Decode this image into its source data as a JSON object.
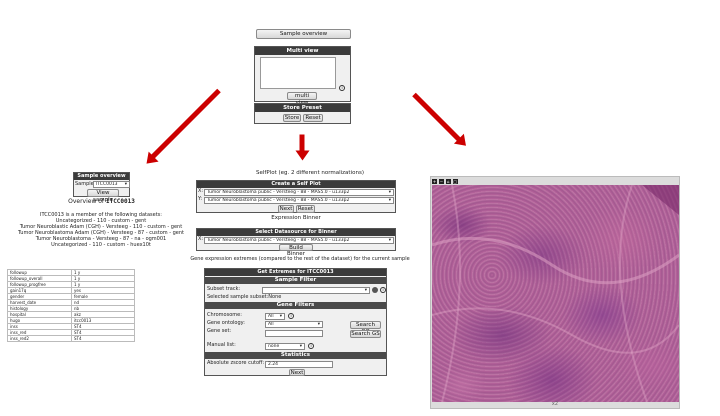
{
  "top": {
    "sample_overview_button": "Sample overview",
    "multi_view_title": "Multi view",
    "multi_view_button": "multi view",
    "store_preset_title": "Store Preset",
    "store_button": "Store",
    "reset_button": "Reset"
  },
  "overview": {
    "panel_title": "Sample overview",
    "sample_label": "Sample",
    "sample_value": "ITCC0013",
    "view_button": "View sample",
    "heading_prefix": "Overview of ",
    "heading_id": "ITCC0013",
    "member_text": "ITCC0013 is a member of the following datasets:",
    "datasets": [
      "Uncategorized - 110 - custom - gent",
      "Tumor Neuroblastic Adam (CGH) - Versteeg - 110 - custom - gent",
      "Tumor Neuroblastoma Adam (CGH) - Versteeg - 87 - custom - gent",
      "Tumor Neuroblastoma - Versteeg - 87 - na - ogm001",
      "Uncategorized - 110 - custom - huex10t"
    ],
    "attributes": [
      [
        "followup",
        "1 y"
      ],
      [
        "followup_overall",
        "1 y"
      ],
      [
        "followup_progfree",
        "1 y"
      ],
      [
        "gain17q",
        "yes"
      ],
      [
        "gender",
        "female"
      ],
      [
        "harvest_date",
        "nd"
      ],
      [
        "histology",
        "nb"
      ],
      [
        "hospital",
        "akz"
      ],
      [
        "hugo",
        "itcc0013"
      ],
      [
        "inss",
        "ST4"
      ],
      [
        "inss_red",
        "ST4"
      ],
      [
        "inss_red2",
        "ST4"
      ]
    ]
  },
  "middle": {
    "selfplot_caption": "SelfPlot (eg. 2 different normalizations)",
    "create_title": "Create a Self Plot",
    "x_label": "X:",
    "y_label": "Y:",
    "x_value": "Tumor Neuroblastoma public - Versteeg - 88 - MAS5.0 - u133p2",
    "y_value": "Tumor Neuroblastoma public - Versteeg - 88 - MAS5.0 - u133p2",
    "next_button": "Next",
    "reset_button": "Reset",
    "binner_caption": "Expression Binner",
    "binner_title": "Select Datasource for Binner",
    "binner_value": "Tumor Neuroblastoma public - Versteeg - 88 - MAS5.0 - u133p2",
    "build_button": "Build Binner",
    "extremes_caption": "Gene expression extremes (compared to the rest of the dataset) for the current sample"
  },
  "extremes": {
    "title": "Get Extremes for ITCC0013",
    "sample_filter": "Sample Filter",
    "subset_label": "Subset track:",
    "selected_subset": "Selected sample subset:None",
    "gene_filters": "Gene Filters",
    "chromosome_label": "Chromosome:",
    "chromosome_value": "All",
    "ontology_label": "Gene ontology:",
    "ontology_value": "All",
    "geneset_label": "Gene set:",
    "search_go": "Search GO",
    "search_gs": "Search GS",
    "manual_label": "Manual list:",
    "manual_value": "none",
    "statistics": "Statistics",
    "zscore_label": "Absolute zscore cutoff:",
    "zscore_value": "2.24",
    "next_button": "Next"
  },
  "image_viewer": {
    "toolbar_icons": [
      "zoom-in-icon",
      "zoom-out-icon",
      "home-icon",
      "fullscreen-icon"
    ],
    "footer_label": "x2"
  }
}
